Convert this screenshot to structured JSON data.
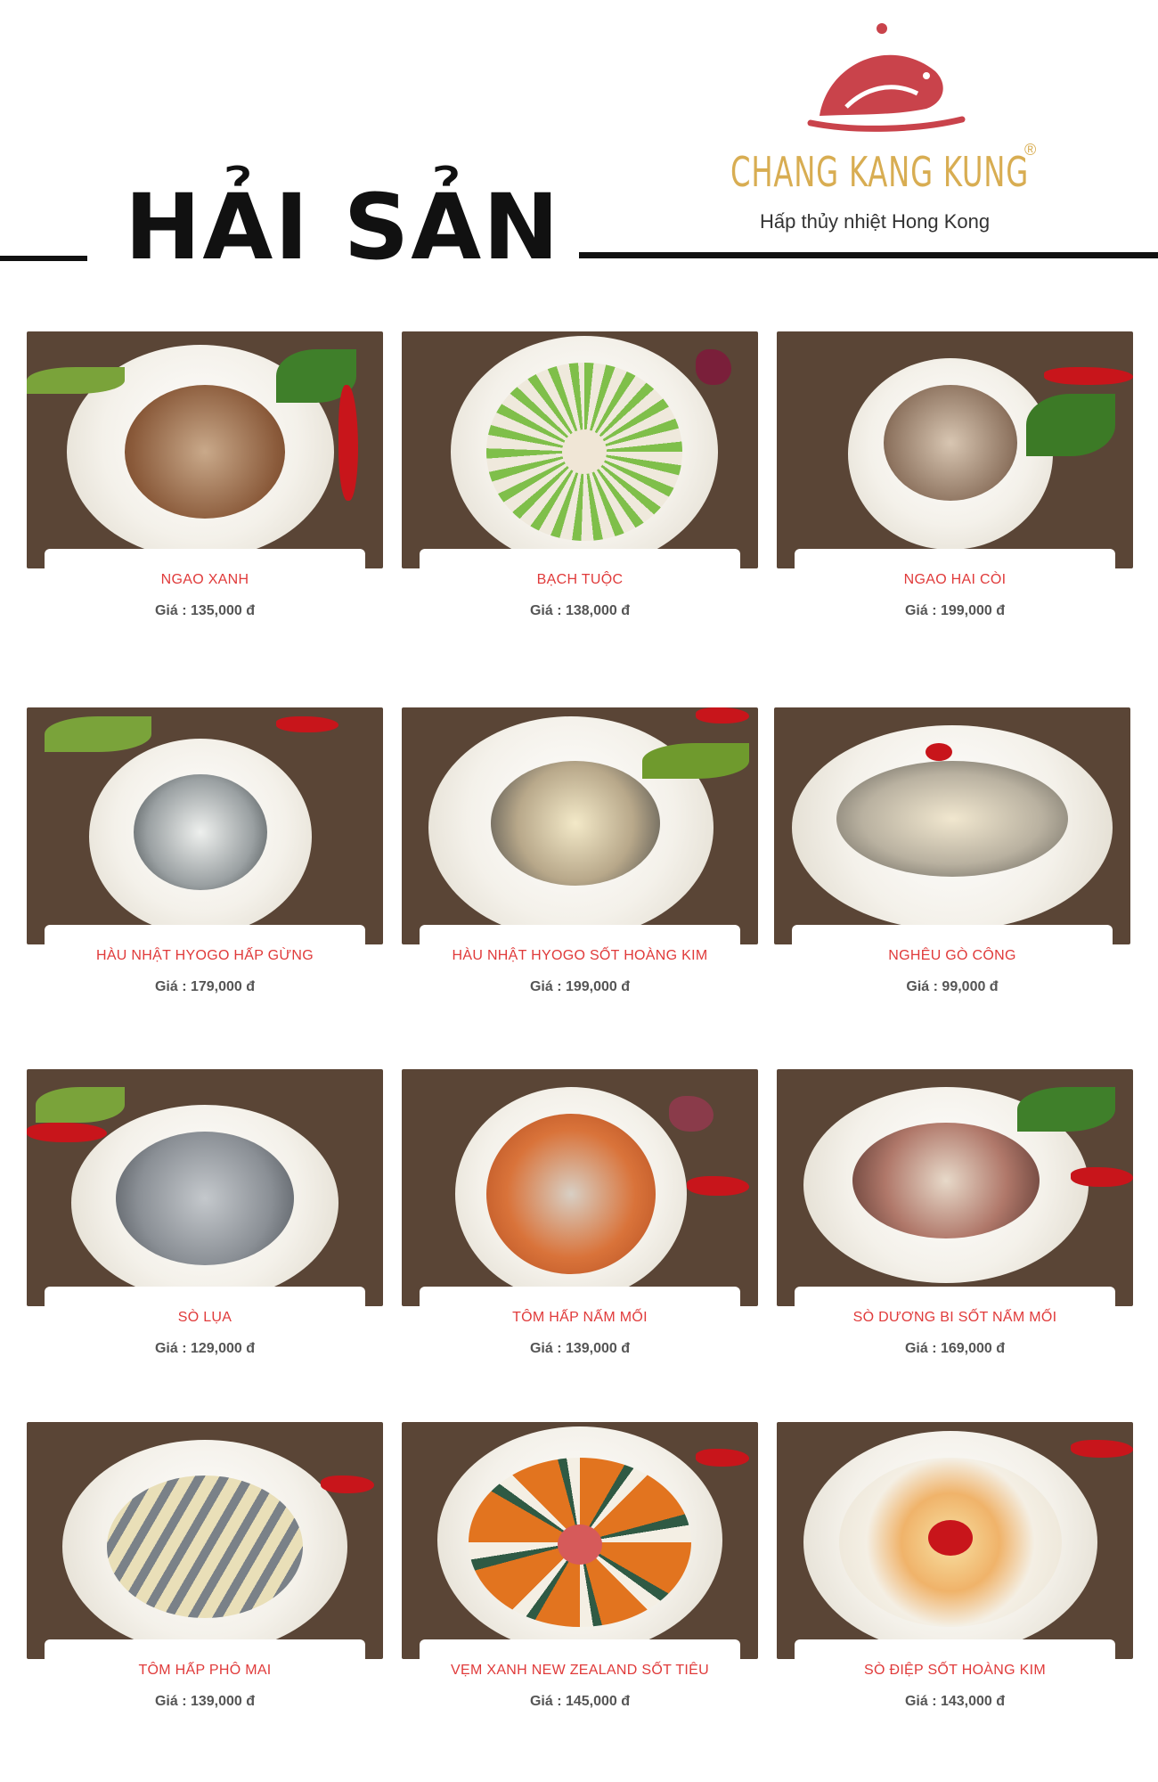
{
  "header": {
    "title": "HẢI SẢN",
    "brand": "CHANG KANG KUNG",
    "registered": "®",
    "tagline": "Hấp thủy nhiệt Hong Kong"
  },
  "colors": {
    "brand_red": "#c9434b",
    "brand_gold": "#d8ad52",
    "dish_name": "#e03a3a",
    "price_text": "#555555"
  },
  "price_label": "Giá :",
  "dishes": [
    {
      "name": "NGAO XANH",
      "price": "135,000 đ"
    },
    {
      "name": "BẠCH TUỘC",
      "price": "138,000 đ"
    },
    {
      "name": "NGAO HAI CÒI",
      "price": "199,000 đ"
    },
    {
      "name": "HÀU NHẬT HYOGO HẤP GỪNG",
      "price": "179,000 đ"
    },
    {
      "name": "HÀU NHẬT HYOGO SỐT HOÀNG KIM",
      "price": "199,000 đ"
    },
    {
      "name": "NGHÊU GÒ CÔNG",
      "price": "99,000 đ"
    },
    {
      "name": "SÒ LỤA",
      "price": "129,000 đ"
    },
    {
      "name": "TÔM HẤP NẤM MỐI",
      "price": "139,000 đ"
    },
    {
      "name": "SÒ DƯƠNG BI SỐT NẤM MỐI",
      "price": "169,000 đ"
    },
    {
      "name": "TÔM HẤP PHÔ MAI",
      "price": "139,000 đ"
    },
    {
      "name": "VẸM XANH NEW ZEALAND SỐT TIÊU",
      "price": "145,000 đ"
    },
    {
      "name": "SÒ ĐIỆP SỐT HOÀNG KIM",
      "price": "143,000 đ"
    }
  ]
}
